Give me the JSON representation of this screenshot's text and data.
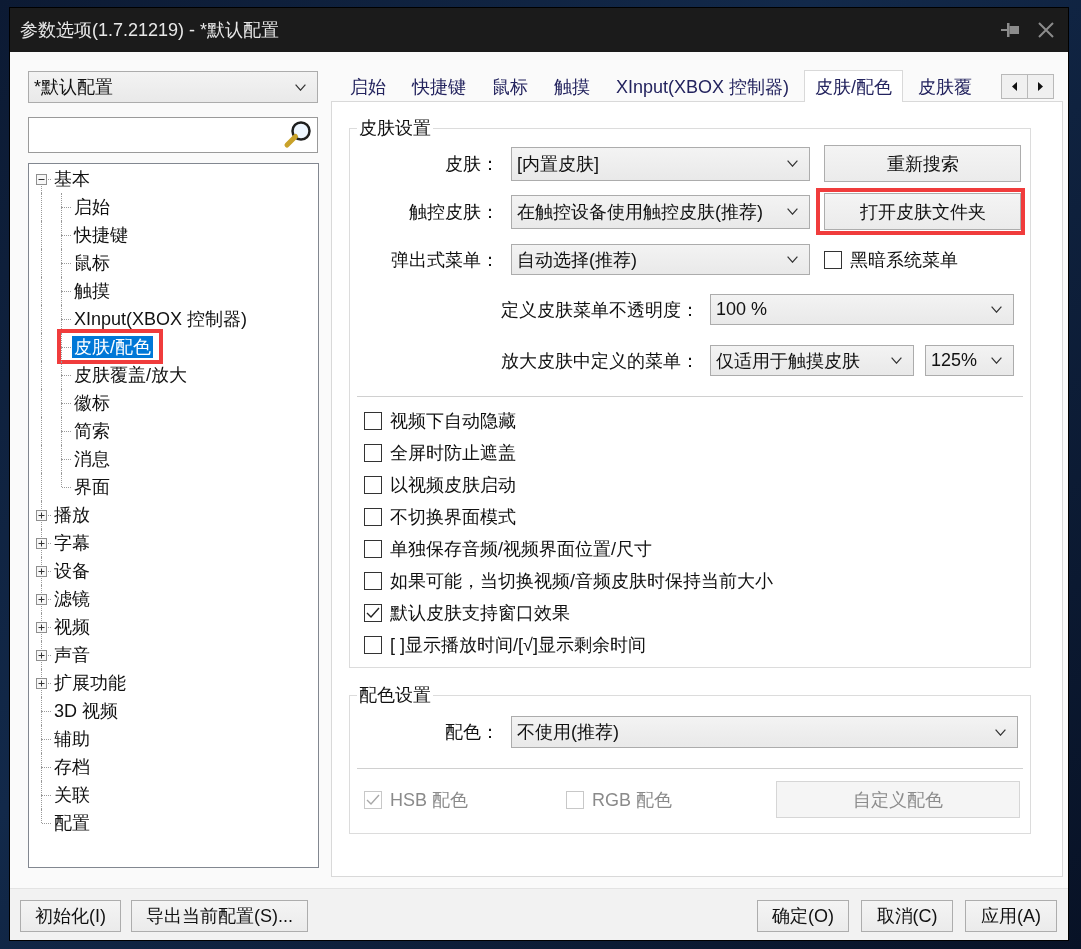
{
  "window": {
    "title": "参数选项(1.7.21219) - *默认配置"
  },
  "sidebar": {
    "profile": {
      "value": "*默认配置"
    }
  },
  "tree": [
    {
      "label": "基本",
      "expanded": true,
      "selected": false,
      "highlighted": false,
      "children": [
        {
          "label": "启始",
          "selected": false,
          "highlighted": false
        },
        {
          "label": "快捷键",
          "selected": false,
          "highlighted": false
        },
        {
          "label": "鼠标",
          "selected": false,
          "highlighted": false
        },
        {
          "label": "触摸",
          "selected": false,
          "highlighted": false
        },
        {
          "label": "XInput(XBOX 控制器)",
          "selected": false,
          "highlighted": false
        },
        {
          "label": "皮肤/配色",
          "selected": true,
          "highlighted": true
        },
        {
          "label": "皮肤覆盖/放大",
          "selected": false,
          "highlighted": false
        },
        {
          "label": "徽标",
          "selected": false,
          "highlighted": false
        },
        {
          "label": "简索",
          "selected": false,
          "highlighted": false
        },
        {
          "label": "消息",
          "selected": false,
          "highlighted": false
        },
        {
          "label": "界面",
          "selected": false,
          "highlighted": false
        }
      ]
    },
    {
      "label": "播放",
      "expanded": false,
      "selected": false,
      "highlighted": false
    },
    {
      "label": "字幕",
      "expanded": false,
      "selected": false,
      "highlighted": false
    },
    {
      "label": "设备",
      "expanded": false,
      "selected": false,
      "highlighted": false
    },
    {
      "label": "滤镜",
      "expanded": false,
      "selected": false,
      "highlighted": false
    },
    {
      "label": "视频",
      "expanded": false,
      "selected": false,
      "highlighted": false
    },
    {
      "label": "声音",
      "expanded": false,
      "selected": false,
      "highlighted": false
    },
    {
      "label": "扩展功能",
      "expanded": false,
      "selected": false,
      "highlighted": false
    },
    {
      "label": "3D 视频",
      "selected": false,
      "highlighted": false
    },
    {
      "label": "辅助",
      "selected": false,
      "highlighted": false
    },
    {
      "label": "存档",
      "selected": false,
      "highlighted": false
    },
    {
      "label": "关联",
      "selected": false,
      "highlighted": false
    },
    {
      "label": "配置",
      "selected": false,
      "highlighted": false
    }
  ],
  "tabs": [
    {
      "label": "启始",
      "selected": false
    },
    {
      "label": "快捷键",
      "selected": false
    },
    {
      "label": "鼠标",
      "selected": false
    },
    {
      "label": "触摸",
      "selected": false
    },
    {
      "label": "XInput(XBOX 控制器)",
      "selected": false
    },
    {
      "label": "皮肤/配色",
      "selected": true
    },
    {
      "label": "皮肤覆",
      "selected": false
    }
  ],
  "skin_group": {
    "title": "皮肤设置",
    "skin": {
      "label": "皮肤：",
      "value": "[内置皮肤]"
    },
    "rescan_button": {
      "label": "重新搜索",
      "highlighted": false
    },
    "touch_skin": {
      "label": "触控皮肤：",
      "value": "在触控设备使用触控皮肤(推荐)"
    },
    "open_folder_button": {
      "label": "打开皮肤文件夹",
      "highlighted": true
    },
    "popup_menu": {
      "label": "弹出式菜单：",
      "value": "自动选择(推荐)"
    },
    "dark_menu": {
      "label": "黑暗系统菜单",
      "checked": false
    },
    "menu_opacity": {
      "label": "定义皮肤菜单不透明度：",
      "value": "100 %"
    },
    "menu_scale": {
      "label": "放大皮肤中定义的菜单：",
      "value": "仅适用于触摸皮肤",
      "scale": "125%"
    },
    "options": [
      {
        "label": "视频下自动隐藏",
        "checked": false
      },
      {
        "label": "全屏时防止遮盖",
        "checked": false
      },
      {
        "label": "以视频皮肤启动",
        "checked": false
      },
      {
        "label": "不切换界面模式",
        "checked": false
      },
      {
        "label": "单独保存音频/视频界面位置/尺寸",
        "checked": false
      },
      {
        "label": "如果可能，当切换视频/音频皮肤时保持当前大小",
        "checked": false
      },
      {
        "label": "默认皮肤支持窗口效果",
        "checked": true
      },
      {
        "label": "[ ]显示播放时间/[√]显示剩余时间",
        "checked": false
      }
    ]
  },
  "color_group": {
    "title": "配色设置",
    "scheme": {
      "label": "配色：",
      "value": "不使用(推荐)"
    },
    "hsb": {
      "label": "HSB 配色",
      "checked": true,
      "disabled": true
    },
    "rgb": {
      "label": "RGB 配色",
      "checked": false,
      "disabled": true
    },
    "custom_button": {
      "label": "自定义配色",
      "disabled": true
    }
  },
  "footer": {
    "left_buttons": [
      {
        "label": "初始化(I)"
      },
      {
        "label": "导出当前配置(S)..."
      }
    ],
    "right_buttons": [
      {
        "label": "确定(O)"
      },
      {
        "label": "取消(C)"
      },
      {
        "label": "应用(A)"
      }
    ]
  }
}
